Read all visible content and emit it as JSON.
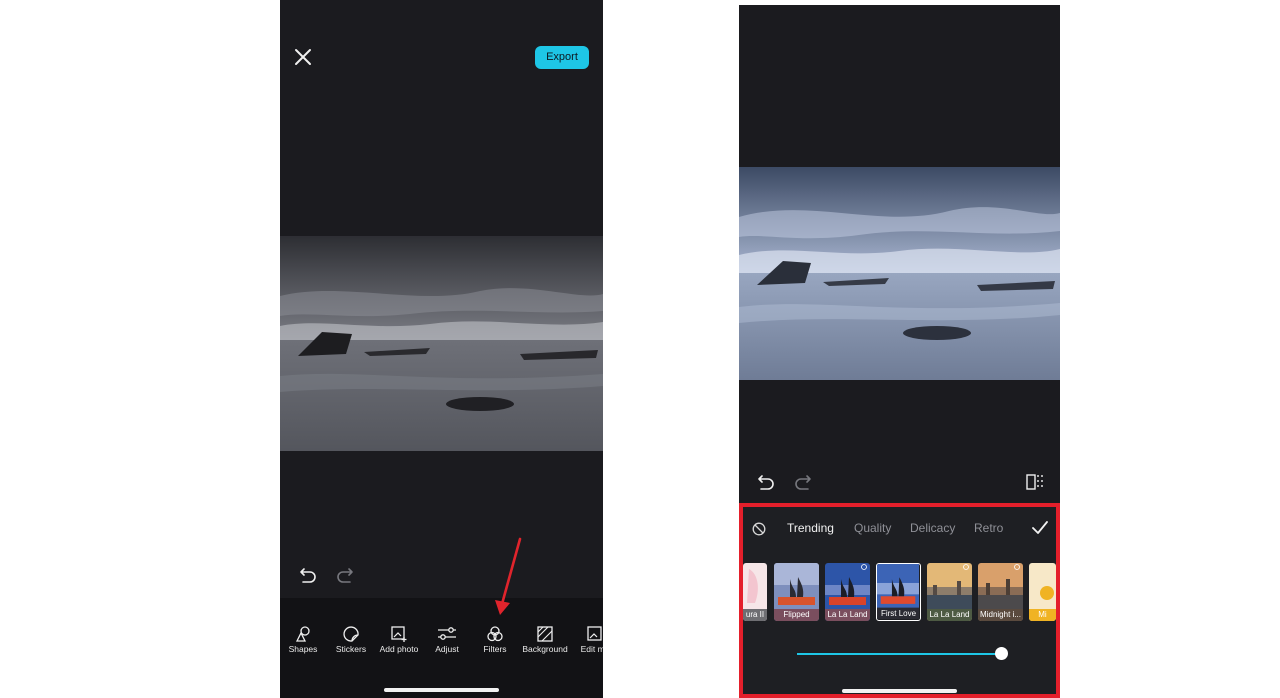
{
  "left_screen": {
    "export_label": "Export",
    "tools": [
      {
        "label": "Shapes",
        "icon": "shapes-icon"
      },
      {
        "label": "Stickers",
        "icon": "stickers-icon"
      },
      {
        "label": "Add photo",
        "icon": "add-photo-icon"
      },
      {
        "label": "Adjust",
        "icon": "adjust-icon"
      },
      {
        "label": "Filters",
        "icon": "filters-icon"
      },
      {
        "label": "Background",
        "icon": "background-icon"
      },
      {
        "label": "Edit mo",
        "icon": "edit-more-icon"
      }
    ],
    "annotation_arrow_color": "#e0242c"
  },
  "right_screen": {
    "filter_tabs": [
      "Trending",
      "Quality",
      "Delicacy",
      "Retro"
    ],
    "active_tab": "Trending",
    "filters": [
      {
        "label": "ura II"
      },
      {
        "label": "Flipped"
      },
      {
        "label": "La La Land"
      },
      {
        "label": "First Love",
        "selected": true
      },
      {
        "label": "La La Land"
      },
      {
        "label": "Midnight i..."
      },
      {
        "label": "Mi"
      }
    ],
    "highlight_color": "#e41f2b",
    "accent_color": "#1ec6e6"
  }
}
